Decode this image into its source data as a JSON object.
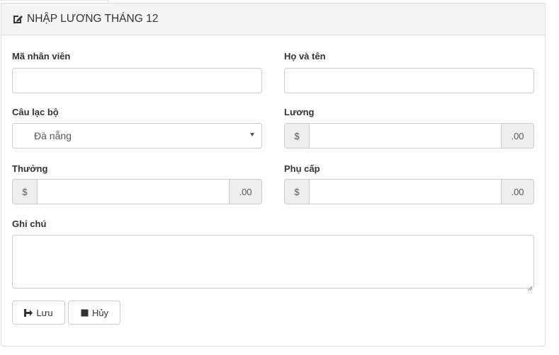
{
  "panel": {
    "title": "NHẬP LƯƠNG THÁNG 12"
  },
  "form": {
    "employee_id": {
      "label": "Mã nhân viên",
      "value": ""
    },
    "full_name": {
      "label": "Họ và tên",
      "value": ""
    },
    "club": {
      "label": "Câu lạc bộ",
      "selected": "Đà nẵng"
    },
    "salary": {
      "label": "Lương",
      "prefix": "$",
      "suffix": ".00",
      "value": ""
    },
    "bonus": {
      "label": "Thưởng",
      "prefix": "$",
      "suffix": ".00",
      "value": ""
    },
    "allowance": {
      "label": "Phụ cấp",
      "prefix": "$",
      "suffix": ".00",
      "value": ""
    },
    "note": {
      "label": "Ghi chú",
      "value": ""
    }
  },
  "actions": {
    "save_label": "Lưu",
    "cancel_label": "Hủy"
  },
  "icons": {
    "title": "edit-icon",
    "save": "save-icon",
    "cancel": "stop-icon"
  }
}
